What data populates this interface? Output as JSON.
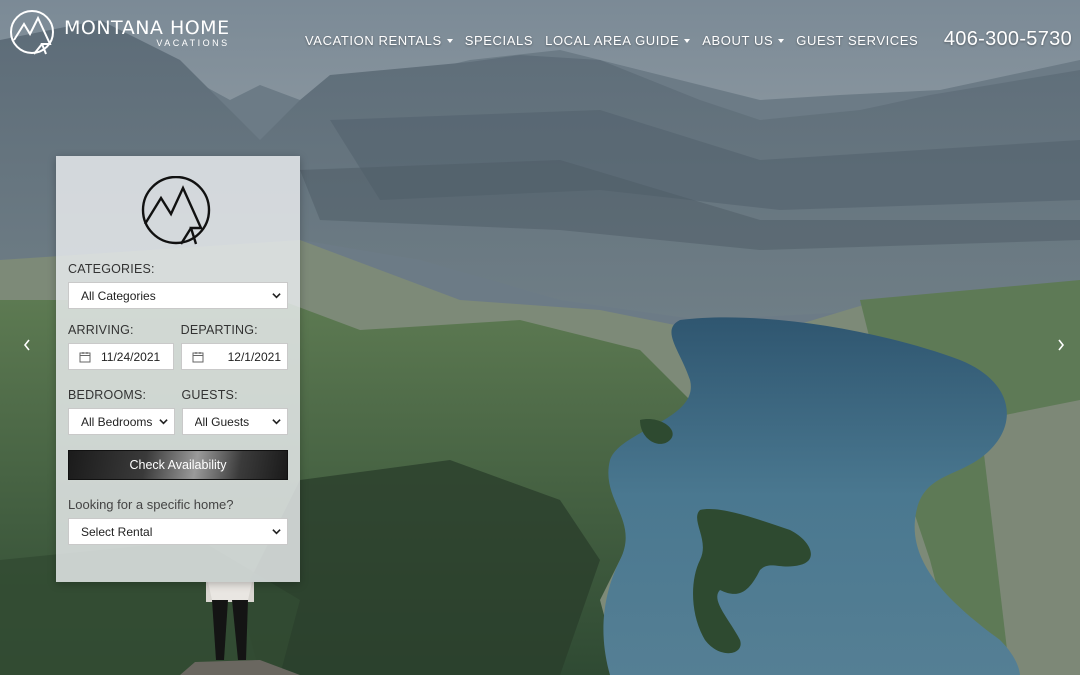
{
  "brand": {
    "title": "MONTANA HOME",
    "subtitle": "VACATIONS"
  },
  "nav": {
    "items": [
      {
        "label": "VACATION RENTALS",
        "has_dropdown": true
      },
      {
        "label": "SPECIALS",
        "has_dropdown": false
      },
      {
        "label": "LOCAL AREA GUIDE",
        "has_dropdown": true
      },
      {
        "label": "ABOUT US",
        "has_dropdown": true
      },
      {
        "label": "GUEST SERVICES",
        "has_dropdown": false
      }
    ],
    "phone": "406-300-5730"
  },
  "search": {
    "categories_label": "CATEGORIES:",
    "categories_value": "All Categories",
    "arriving_label": "ARRIVING:",
    "arriving_value": "11/24/2021",
    "departing_label": "DEPARTING:",
    "departing_value": "12/1/2021",
    "bedrooms_label": "BEDROOMS:",
    "bedrooms_value": "All Bedrooms",
    "guests_label": "GUESTS:",
    "guests_value": "All Guests",
    "submit_label": "Check Availability",
    "specific_label": "Looking for a specific home?",
    "rental_value": "Select Rental"
  },
  "icons": {
    "logo": "mountain-circle-logo",
    "calendar": "calendar-icon",
    "prev": "chevron-left-icon",
    "next": "chevron-right-icon"
  },
  "colors": {
    "panel_bg": "#ebeef0",
    "button_dark": "#1b1b1b",
    "lake": "#3f6a80",
    "forest": "#3a5a3a"
  }
}
